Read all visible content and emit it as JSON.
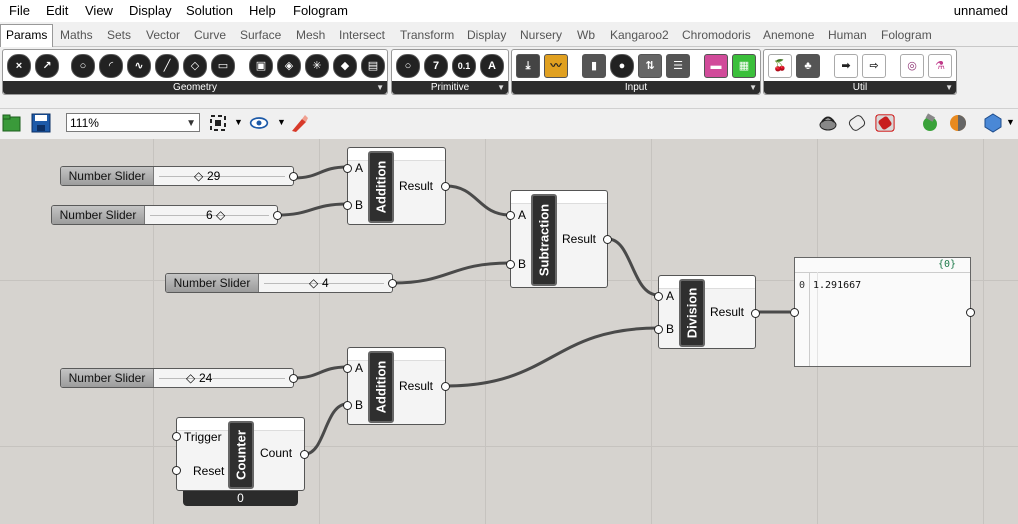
{
  "menubar": {
    "items": [
      "File",
      "Edit",
      "View",
      "Display",
      "Solution",
      "Help",
      "Fologram"
    ],
    "document_title": "unnamed"
  },
  "tabs": [
    "Params",
    "Maths",
    "Sets",
    "Vector",
    "Curve",
    "Surface",
    "Mesh",
    "Intersect",
    "Transform",
    "Display",
    "Nursery",
    "Wb",
    "Kangaroo2",
    "Chromodoris",
    "Anemone",
    "Human",
    "Fologram"
  ],
  "active_tab": "Params",
  "ribbon": {
    "panels": [
      {
        "label": "Geometry"
      },
      {
        "label": "Primitive",
        "glyphs": [
          "7",
          "0.1",
          "A"
        ]
      },
      {
        "label": "Input"
      },
      {
        "label": "Util"
      }
    ]
  },
  "toolbar": {
    "zoom": "111%"
  },
  "canvas": {
    "sliders": [
      {
        "name": "Number Slider",
        "value": "29"
      },
      {
        "name": "Number Slider",
        "value": "6"
      },
      {
        "name": "Number Slider",
        "value": "4"
      },
      {
        "name": "Number Slider",
        "value": "24"
      }
    ],
    "components": {
      "addition1": {
        "name": "Addition",
        "in_a": "A",
        "in_b": "B",
        "out": "Result"
      },
      "subtraction": {
        "name": "Subtraction",
        "in_a": "A",
        "in_b": "B",
        "out": "Result"
      },
      "division": {
        "name": "Division",
        "in_a": "A",
        "in_b": "B",
        "out": "Result"
      },
      "addition2": {
        "name": "Addition",
        "in_a": "A",
        "in_b": "B",
        "out": "Result"
      },
      "counter": {
        "name": "Counter",
        "in_trigger": "Trigger",
        "in_reset": "Reset",
        "out": "Count",
        "value": "0"
      }
    },
    "panel": {
      "path": "{0}",
      "index": "0",
      "value": "1.291667"
    }
  },
  "colors": {
    "canvas": "#d6d3cf",
    "wire": "#4a4a4a",
    "panel_path": "#1d7a4a",
    "component_body": "#2f2f2f"
  }
}
